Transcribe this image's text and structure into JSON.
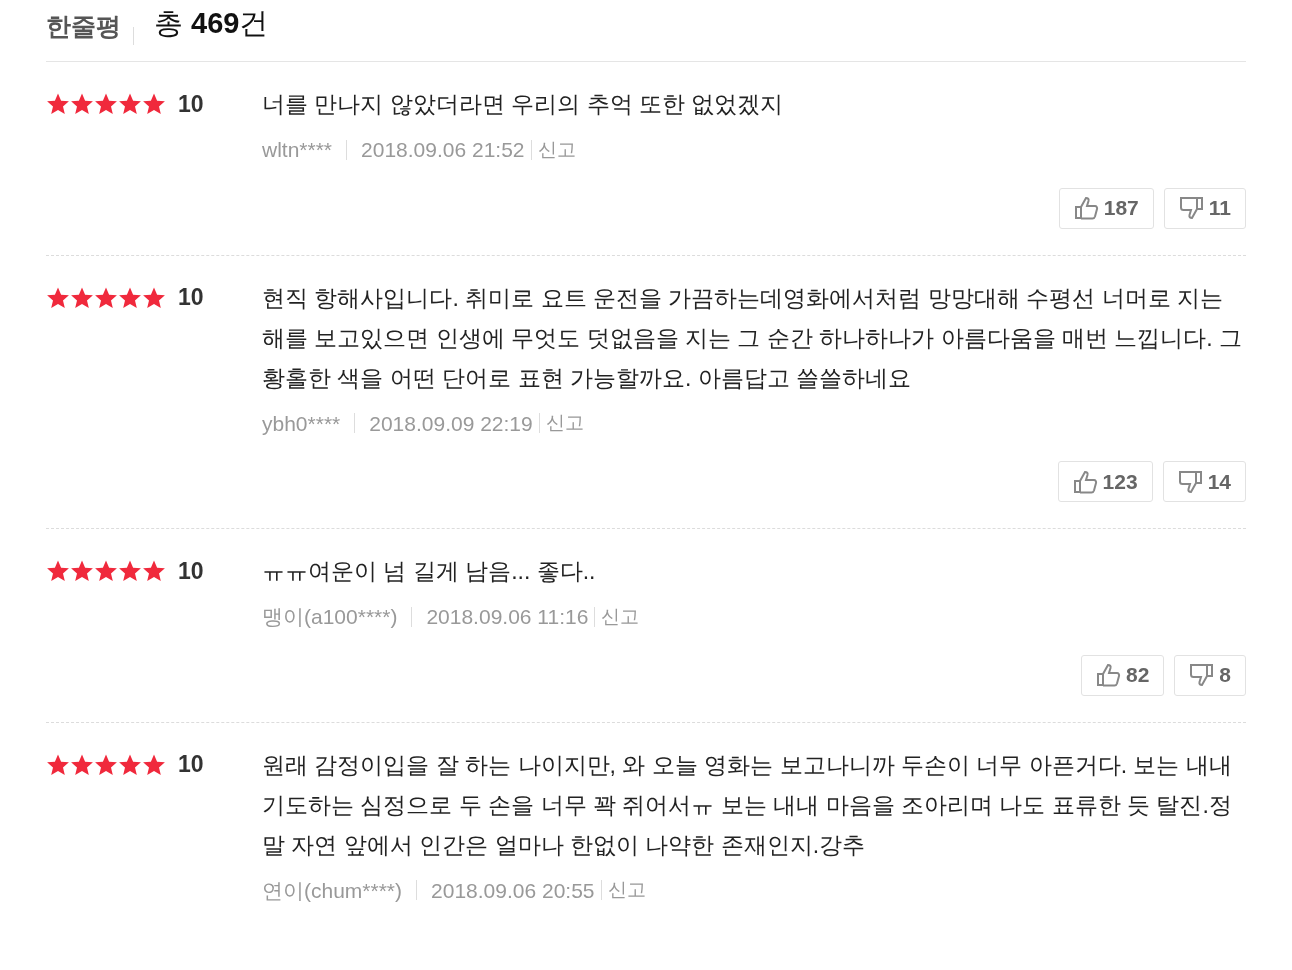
{
  "header": {
    "title": "한줄평",
    "total_prefix": "총",
    "total_count": "469",
    "total_suffix": "건"
  },
  "reviews": [
    {
      "stars": 5,
      "score": "10",
      "text": "너를 만나지 않았더라면 우리의 추억 또한 없었겠지",
      "author": "wltn****",
      "date": "2018.09.06 21:52",
      "report": "신고",
      "likes": "187",
      "dislikes": "11"
    },
    {
      "stars": 5,
      "score": "10",
      "text": "현직 항해사입니다. 취미로 요트 운전을 가끔하는데영화에서처럼 망망대해 수평선 너머로 지는 해를 보고있으면 인생에 무엇도 덧없음을 지는 그 순간 하나하나가 아름다움을 매번 느낍니다. 그 황홀한 색을 어떤 단어로 표현 가능할까요. 아름답고 쓸쓸하네요",
      "author": "ybh0****",
      "date": "2018.09.09 22:19",
      "report": "신고",
      "likes": "123",
      "dislikes": "14"
    },
    {
      "stars": 5,
      "score": "10",
      "text": "ㅠㅠ여운이 넘 길게 남음... 좋다..",
      "author": "맹이(a100****)",
      "date": "2018.09.06 11:16",
      "report": "신고",
      "likes": "82",
      "dislikes": "8"
    },
    {
      "stars": 5,
      "score": "10",
      "text": "원래 감정이입을 잘 하는 나이지만, 와 오늘 영화는 보고나니까 두손이 너무 아픈거다. 보는 내내 기도하는 심정으로 두 손을 너무 꽉 쥐어서ㅠ 보는 내내 마음을 조아리며 나도 표류한 듯 탈진.정말 자연 앞에서 인간은 얼마나 한없이 나약한 존재인지.강추",
      "author": "연이(chum****)",
      "date": "2018.09.06 20:55",
      "report": "신고"
    }
  ]
}
